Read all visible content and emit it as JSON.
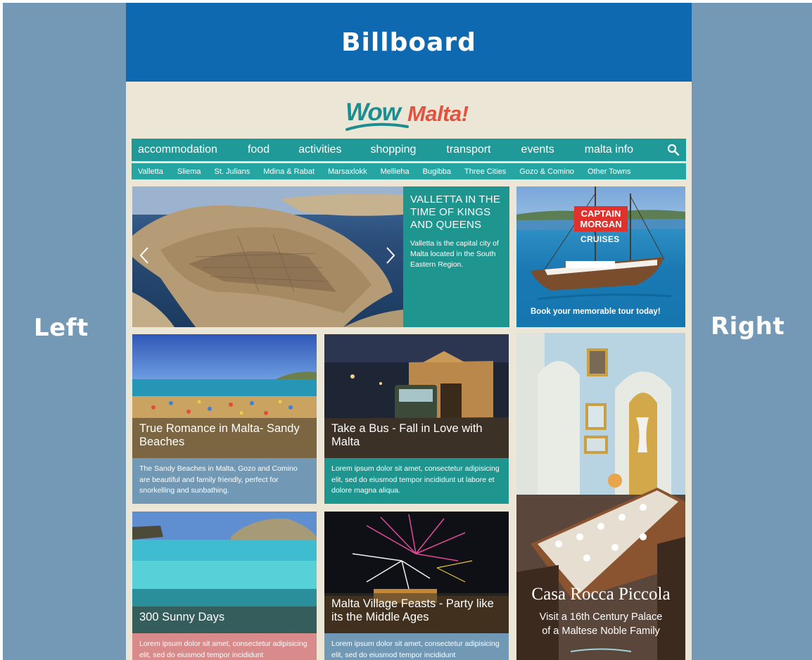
{
  "labels": {
    "billboard": "Billboard",
    "left": "Left",
    "right": "Right"
  },
  "logo": {
    "part1": "Wow",
    "part2": "Malta!"
  },
  "nav": {
    "items": [
      "accommodation",
      "food",
      "activities",
      "shopping",
      "transport",
      "events",
      "malta info"
    ],
    "search_icon": "search-icon"
  },
  "subnav": {
    "items": [
      "Valletta",
      "Sliema",
      "St. Julians",
      "Mdina & Rabat",
      "Marsaxlokk",
      "Mellieha",
      "Bugibba",
      "Three Cities",
      "Gozo & Comino",
      "Other Towns"
    ]
  },
  "hero": {
    "title": "VALLETTA IN THE TIME OF KINGS AND QUEENS",
    "text": "Valletta is the capital city of Malta located in the South Eastern Region."
  },
  "ads": {
    "captain_morgan": {
      "brand_line1": "CAPTAIN",
      "brand_line2": "MORGAN",
      "tagline": "CRUISES",
      "cta": "Book your memorable tour today!"
    },
    "casa_rocca": {
      "title": "Casa Rocca Piccola",
      "subtitle_line1": "Visit a 16th Century Palace",
      "subtitle_line2": "of a Maltese Noble Family"
    }
  },
  "cards": [
    {
      "title": "True Romance in Malta- Sandy Beaches",
      "body": "The Sandy Beaches in Malta, Gozo and Comino are beautiful and family friendly, perfect for snorkelling and sunbathing.",
      "color": "#7199b6"
    },
    {
      "title": "Take a Bus - Fall in Love with Malta",
      "body": "Lorem ipsum dolor sit amet, consectetur adipisicing elit, sed do eiusmod tempor incididunt ut labore et dolore magna aliqua.",
      "color": "#1f958f"
    },
    {
      "title": "300 Sunny Days",
      "body": "Lorem ipsum dolor sit amet, consectetur adipisicing elit, sed do eiusmod tempor incididunt",
      "color": "#d98a8a"
    },
    {
      "title": "Malta Village Feasts - Party like its the Middle Ages",
      "body": "Lorem ipsum dolor sit amet, consectetur adipisicing elit, sed do eiusmod tempor incididunt",
      "color": "#7199b6"
    }
  ],
  "colors": {
    "frame": "#7399b6",
    "billboard": "#0e69b0",
    "site_bg": "#ece6d7",
    "nav": "#1f9a98",
    "subnav": "#26a6a2",
    "logo_teal": "#1c8e8f",
    "logo_red": "#e4513f"
  }
}
